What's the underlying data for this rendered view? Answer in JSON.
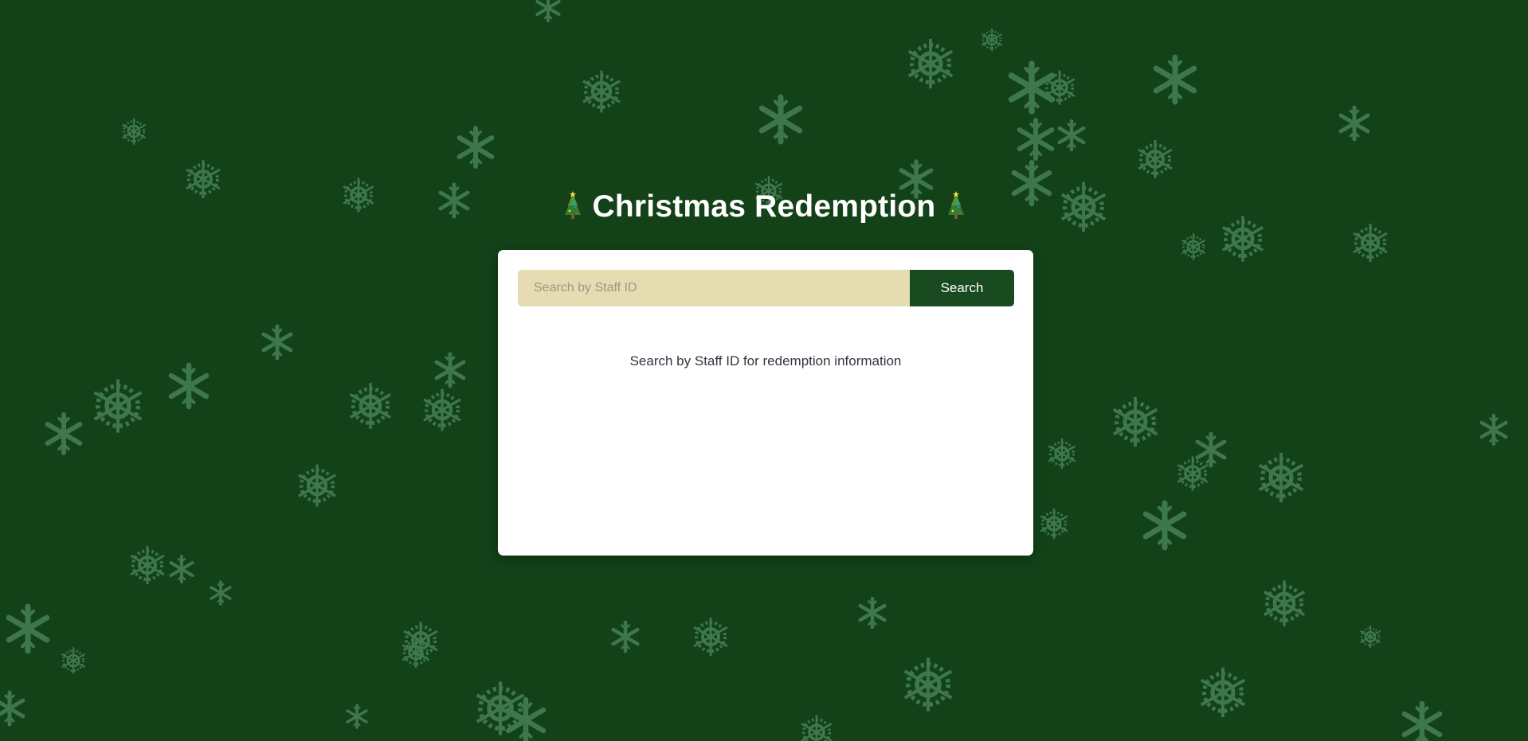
{
  "page": {
    "title": "Christmas Redemption",
    "title_icon": "christmas-tree-icon",
    "background_color": "#134118",
    "snowflake_color": "#4a8a5a"
  },
  "search": {
    "placeholder": "Search by Staff ID",
    "value": "",
    "button_label": "Search",
    "input_color": "#e6dcb1",
    "button_color": "#1a4a1f"
  },
  "results": {
    "hint": "Search by Staff ID for redemption information"
  }
}
